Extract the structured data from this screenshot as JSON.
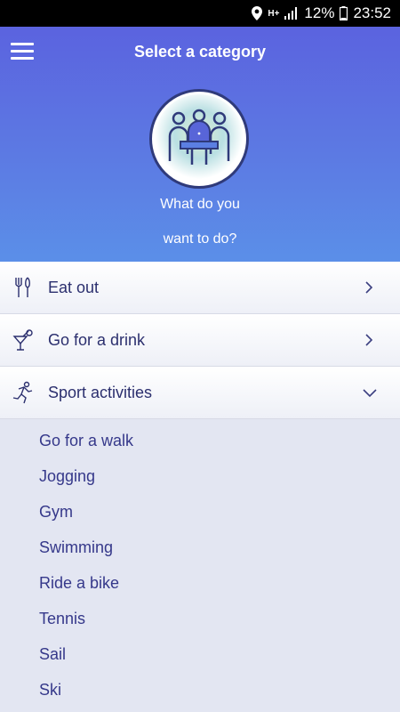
{
  "status_bar": {
    "network": "H+",
    "battery": "12%",
    "time": "23:52"
  },
  "header": {
    "title": "Select a category",
    "subtitle_line1": "What do you",
    "subtitle_line2": "want to do?"
  },
  "categories": [
    {
      "label": "Eat out",
      "icon": "fork-knife-icon",
      "state": "collapsed"
    },
    {
      "label": "Go for a drink",
      "icon": "cocktail-icon",
      "state": "collapsed"
    },
    {
      "label": "Sport activities",
      "icon": "running-icon",
      "state": "expanded"
    }
  ],
  "sport_items": [
    "Go for a walk",
    "Jogging",
    "Gym",
    "Swimming",
    "Ride a bike",
    "Tennis",
    "Sail",
    "Ski"
  ],
  "colors": {
    "header_top": "#5b63df",
    "header_bottom": "#5b8fe8",
    "text_dark": "#2b2f6e",
    "sub_text": "#35388a",
    "list_bg": "#e3e6f2"
  }
}
